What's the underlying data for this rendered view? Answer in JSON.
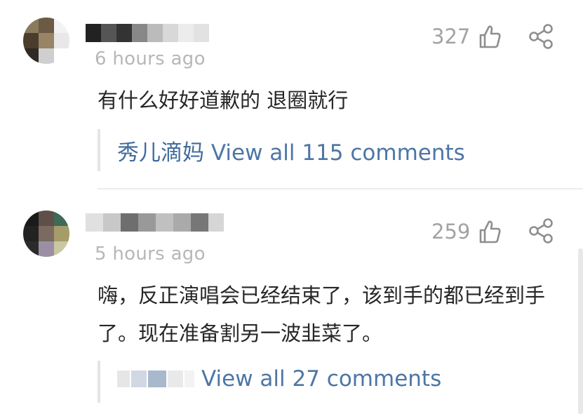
{
  "comments": [
    {
      "time": "6 hours ago",
      "likes": "327",
      "text": "有什么好好道歉的 退圈就行",
      "reply": {
        "name": "秀儿滴妈",
        "link": "View all 115 comments"
      }
    },
    {
      "time": "5 hours ago",
      "likes": "259",
      "text": "嗨，反正演唱会已经结束了，该到手的都已经到手了。现在准备割另一波韭菜了。",
      "reply": {
        "name": "",
        "link": "View all 27 comments"
      }
    }
  ],
  "icons": {
    "like": "thumbs-up-icon",
    "share": "share-icon"
  },
  "colors": {
    "link": "#4d76a6",
    "meta": "#b7b7b7",
    "text": "#262626"
  }
}
